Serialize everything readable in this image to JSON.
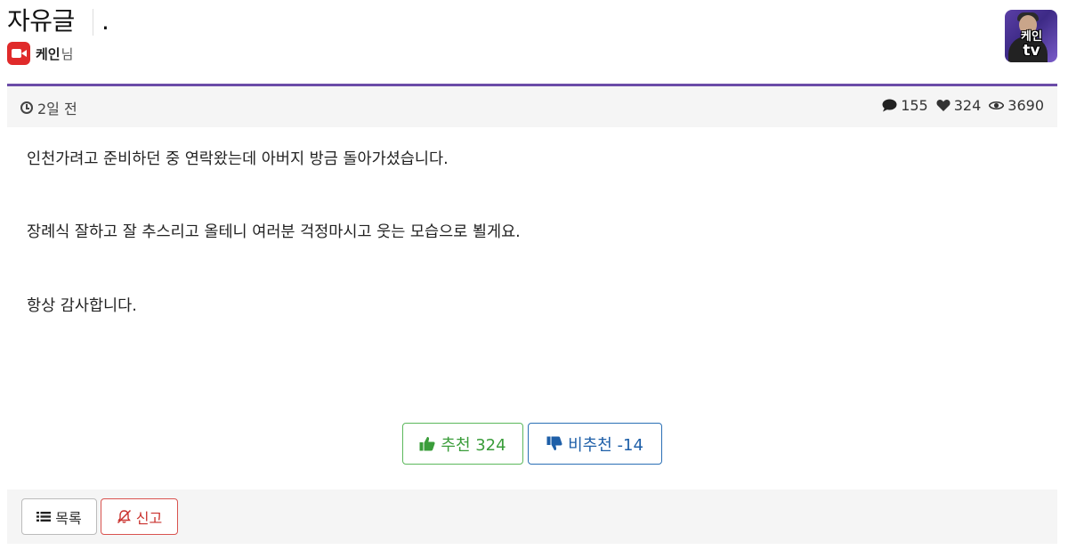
{
  "header": {
    "board_title": "자유글",
    "post_title": ".",
    "author": {
      "name": "케인",
      "suffix": "님"
    },
    "profile_text_top": "케인",
    "profile_text_bottom": "tv"
  },
  "meta": {
    "time": "2일 전",
    "comments": "155",
    "likes": "324",
    "views": "3690"
  },
  "content": {
    "paragraphs": [
      "인천가려고 준비하던 중 연락왔는데 아버지 방금 돌아가셨습니다.",
      "장례식 잘하고 잘 추스리고 올테니 여러분 걱정마시고 웃는 모습으로 뵐게요.",
      "항상 감사합니다."
    ]
  },
  "votes": {
    "up_label": "추천 324",
    "down_label": "비추천 -14"
  },
  "footer": {
    "list_label": "목록",
    "report_label": "신고"
  },
  "colors": {
    "accent_divider": "#6b4ca8",
    "upvote": "#5cb85c",
    "downvote": "#2a6fb5",
    "report": "#d9534f",
    "author_icon": "#e02a2a"
  },
  "icons": {
    "author": "video-camera-icon",
    "time": "clock-icon",
    "comments": "comment-icon",
    "likes": "heart-icon",
    "views": "eye-icon",
    "upvote": "thumbs-up-icon",
    "downvote": "thumbs-down-icon",
    "list": "list-icon",
    "report": "bell-slash-icon"
  }
}
